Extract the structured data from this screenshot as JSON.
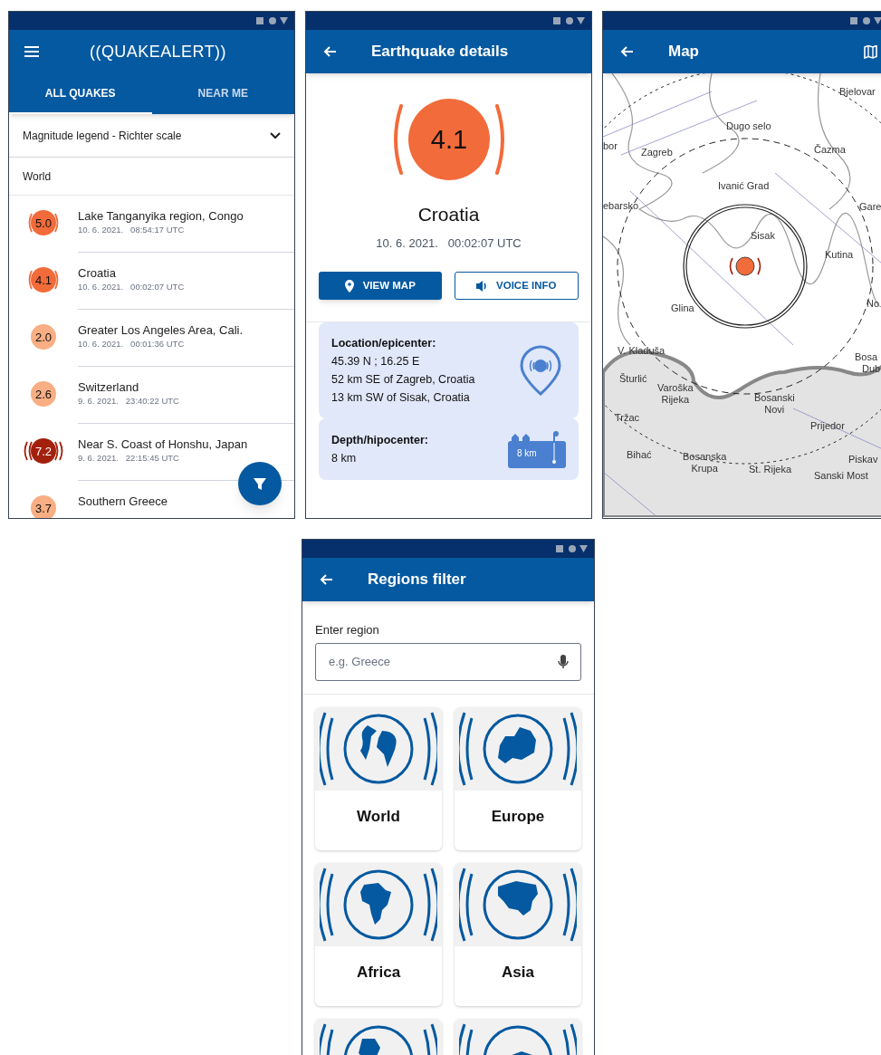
{
  "list_screen": {
    "logo": "((QUAKEALERT))",
    "tabs": [
      {
        "label": "ALL QUAKES",
        "selected": true
      },
      {
        "label": "NEAR ME",
        "selected": false
      }
    ],
    "legend": {
      "label": "Magnitude legend - Richter scale",
      "expanded": false
    },
    "region": "World",
    "quakes": [
      {
        "magnitude": "5.0",
        "kind": "moderate",
        "color": "#f26b3a",
        "place": "Lake Tanganyika region, Congo",
        "time": "10. 6. 2021.   08:54:17 UTC"
      },
      {
        "magnitude": "4.1",
        "kind": "moderate",
        "color": "#f26b3a",
        "place": "Croatia",
        "time": "10. 6. 2021.   00:02:07 UTC"
      },
      {
        "magnitude": "2.0",
        "kind": "minor",
        "color": "#f9ae84",
        "place": "Greater Los Angeles Area, Cali.",
        "time": "10. 6. 2021.   00:01:36 UTC"
      },
      {
        "magnitude": "2.6",
        "kind": "minor",
        "color": "#f9ae84",
        "place": "Switzerland",
        "time": "9. 6. 2021.   23:40:22 UTC"
      },
      {
        "magnitude": "7.2",
        "kind": "major",
        "color": "#a3200c",
        "place": "Near S. Coast of Honshu, Japan",
        "time": "9. 6. 2021.   22:15:45 UTC"
      },
      {
        "magnitude": "3.7",
        "kind": "minor",
        "color": "#f9ae84",
        "place": "Southern Greece"
      }
    ]
  },
  "details_screen": {
    "title": "Earthquake details",
    "magnitude": "4.1",
    "color": "#f26b3a",
    "place": "Croatia",
    "time": "10. 6. 2021.   00:02:07 UTC",
    "buttons": [
      {
        "label": "VIEW MAP",
        "kind": "primary"
      },
      {
        "label": "VOICE INFO",
        "kind": "outline"
      }
    ],
    "cards": [
      {
        "kind": "location",
        "heading": "Location/epicenter:",
        "lines": [
          "45.39 N ; 16.25 E",
          "52 km SE of Zagreb, Croatia",
          "13 km SW of Sisak, Croatia"
        ]
      },
      {
        "kind": "depth",
        "heading": "Depth/hipocenter:",
        "lines": [
          "8 km"
        ],
        "icon_text": "8 km"
      }
    ]
  },
  "map_screen": {
    "title": "Map",
    "labels": [
      "Bjelovar",
      "Dugo selo",
      "bor",
      "Zagreb",
      "Čazma",
      "Ivanić Grad",
      "ebarsko",
      "Gare",
      "Sisak",
      "Kutina",
      "Glina",
      "No",
      "V. Kladuša",
      "Bosa",
      "Dub",
      "Šturlić",
      "Varoška\nRijeka",
      "Bosanski\nNovi",
      "Tržac",
      "Prijedor",
      "Bihać",
      "Bosanska\nKrupa",
      "St. Rijeka",
      "Piskav",
      "Sanski Most"
    ]
  },
  "regions_screen": {
    "title": "Regions filter",
    "field_label": "Enter region",
    "placeholder": "e.g. Greece",
    "regions": [
      {
        "label": "World",
        "kind": "world"
      },
      {
        "label": "Europe",
        "kind": "europe"
      },
      {
        "label": "Africa",
        "kind": "africa"
      },
      {
        "label": "Asia",
        "kind": "asia"
      },
      {
        "kind": "americas"
      },
      {
        "kind": "oceania"
      }
    ]
  }
}
